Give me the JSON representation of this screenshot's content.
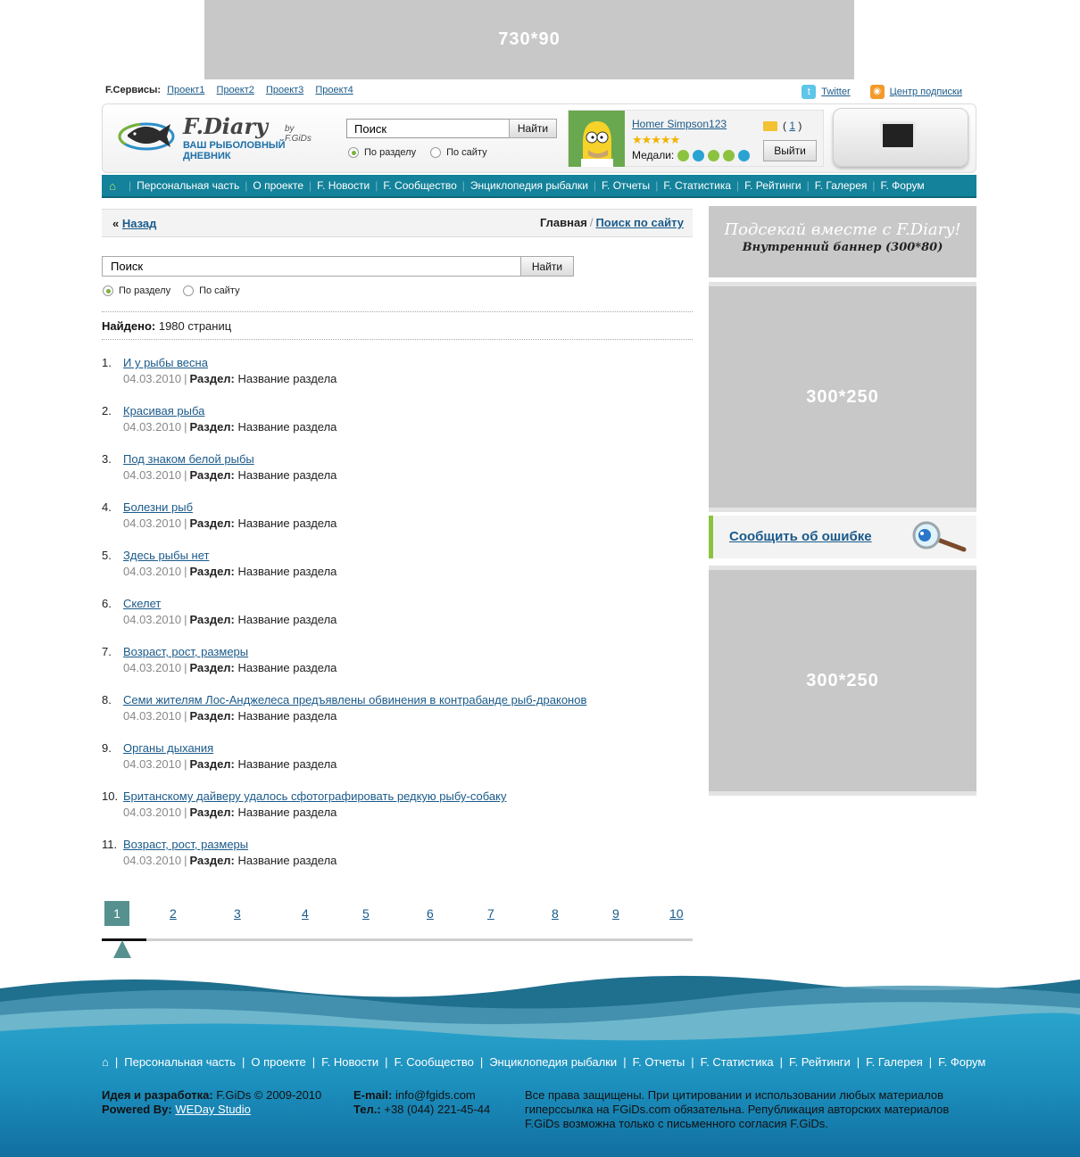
{
  "top_banner": {
    "label": "730*90"
  },
  "services": {
    "label": "F.Сервисы:",
    "links": [
      "Проект1",
      "Проект2",
      "Проект3",
      "Проект4"
    ],
    "twitter": "Twitter",
    "subscription": "Центр подписки"
  },
  "logo": {
    "title": "F.Diary",
    "by": "by F.GiDs",
    "subtitle": "ВАШ РЫБОЛОВНЫЙ ДНЕВНИК"
  },
  "header_search": {
    "placeholder": "Поиск",
    "value": "Поиск",
    "button": "Найти",
    "radio_section": "По разделу",
    "radio_site": "По сайту",
    "selected": "По разделу"
  },
  "user": {
    "name": "Homer Simpson123",
    "rating_stars": 5,
    "medals_label": "Медали:",
    "messages_count": "1",
    "logout": "Выйти"
  },
  "nav": {
    "items": [
      "Персональная часть",
      "О проекте",
      "F. Новости",
      "F. Сообщество",
      "Энциклопедия рыбалки",
      "F. Отчеты",
      "F. Статистика",
      "F. Рейтинги",
      "F. Галерея",
      "F. Форум"
    ]
  },
  "breadcrumb": {
    "back_arrow": "«",
    "back": "Назад",
    "home": "Главная",
    "separator": "/",
    "current": "Поиск по сайту"
  },
  "search": {
    "value": "Поиск",
    "button": "Найти",
    "radio_section": "По разделу",
    "radio_site": "По сайту",
    "selected": "По разделу"
  },
  "found": {
    "label": "Найдено:",
    "value": "1980 страниц"
  },
  "results": [
    {
      "num": "1.",
      "title": "И у рыбы весна",
      "date": "04.03.2010",
      "section_label": "Раздел:",
      "section": "Название раздела"
    },
    {
      "num": "2.",
      "title": "Красивая рыба",
      "date": "04.03.2010",
      "section_label": "Раздел:",
      "section": "Название раздела"
    },
    {
      "num": "3.",
      "title": "Под знаком белой рыбы",
      "date": "04.03.2010",
      "section_label": "Раздел:",
      "section": "Название раздела"
    },
    {
      "num": "4.",
      "title": "Болезни рыб",
      "date": "04.03.2010",
      "section_label": "Раздел:",
      "section": "Название раздела"
    },
    {
      "num": "5.",
      "title": "Здесь рыбы нет",
      "date": "04.03.2010",
      "section_label": "Раздел:",
      "section": "Название раздела"
    },
    {
      "num": "6.",
      "title": "Скелет",
      "date": "04.03.2010",
      "section_label": "Раздел:",
      "section": "Название раздела"
    },
    {
      "num": "7.",
      "title": "Возраст, рост, размеры",
      "date": "04.03.2010",
      "section_label": "Раздел:",
      "section": "Название раздела"
    },
    {
      "num": "8.",
      "title": "Семи жителям Лос-Анджелеса предъявлены обвинения в контрабанде рыб-драконов",
      "date": "04.03.2010",
      "section_label": "Раздел:",
      "section": "Название раздела"
    },
    {
      "num": "9.",
      "title": "Органы дыхания",
      "date": "04.03.2010",
      "section_label": "Раздел:",
      "section": "Название раздела"
    },
    {
      "num": "10.",
      "title": "Британскому дайверу удалось сфотографировать редкую рыбу-собаку",
      "date": "04.03.2010",
      "section_label": "Раздел:",
      "section": "Название раздела"
    },
    {
      "num": "11.",
      "title": "Возраст, рост, размеры",
      "date": "04.03.2010",
      "section_label": "Раздел:",
      "section": "Название раздела"
    }
  ],
  "pager": {
    "pages": [
      "1",
      "2",
      "3",
      "4",
      "5",
      "6",
      "7",
      "8",
      "9",
      "10"
    ],
    "current": "1"
  },
  "sidebar": {
    "banner_title": "Подсекай вместе с F.Diary!",
    "banner_sub": "Внутренний баннер (300*80)",
    "ad1": "300*250",
    "report": "Сообщить об ошибке",
    "ad2": "300*250"
  },
  "footer": {
    "nav": [
      "Персональная часть",
      "О проекте",
      "F. Новости",
      "F. Сообщество",
      "Энциклопедия рыбалки",
      "F. Отчеты",
      "F. Статистика",
      "F. Рейтинги",
      "F. Галерея",
      "F. Форум"
    ],
    "idea_label": "Идея и разработка:",
    "idea_value": "F.GiDs © 2009-2010",
    "powered_label": "Powered By:",
    "powered_value": "WEDay Studio",
    "email_label": "E-mail:",
    "email_value": "info@fgids.com",
    "phone_label": "Тел.:",
    "phone_value": "+38 (044) 221-45-44",
    "rights": "Все права защищены. При цитировании и использовании любых материалов гиперссылка на FGiDs.com обязательна. Републикация авторских материалов F.GiDs возможна только с письменного согласия F.GiDs."
  },
  "colors": {
    "nav_bg": "#13829a",
    "link": "#1a5a8a",
    "pager_active": "#56918f",
    "accent_green": "#8bc340",
    "ad_gray": "#c8c8c8"
  }
}
